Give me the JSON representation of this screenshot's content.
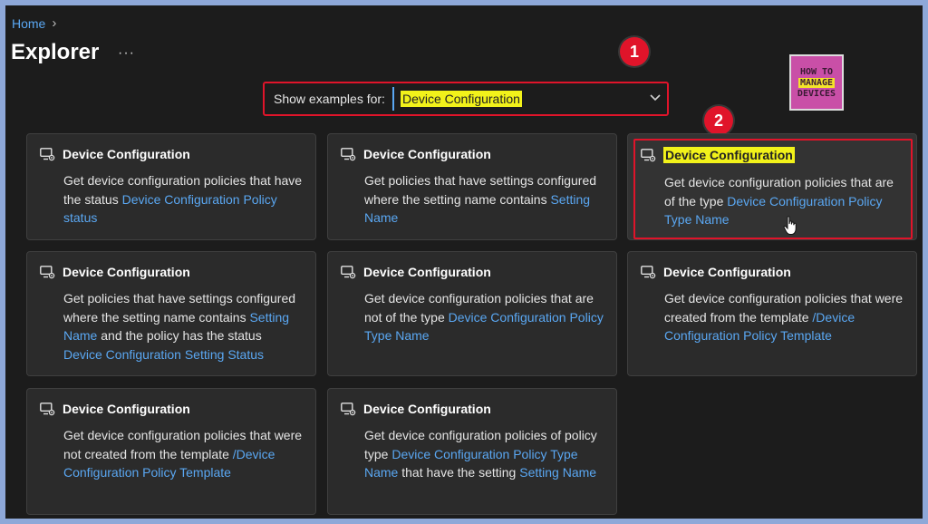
{
  "breadcrumb": {
    "home": "Home"
  },
  "page_title": "Explorer",
  "more_label": "···",
  "filter": {
    "label": "Show examples for:",
    "value": "Device Configuration"
  },
  "markers": [
    "1",
    "2"
  ],
  "logo": {
    "line1": "HOW TO",
    "line2": "MANAGE",
    "line3": "DEVICES"
  },
  "colors": {
    "accent": "#5aa7f2",
    "highlight": "#f2f21a",
    "annotation": "#e0142a",
    "card_bg": "#2b2b2b",
    "page_bg": "#1c1c1c"
  },
  "cards": [
    {
      "title": "Device Configuration",
      "icon": "device-settings-icon",
      "desc": [
        {
          "t": "Get device configuration policies that have the status "
        },
        {
          "t": "Device Configuration Policy status",
          "link": true
        }
      ]
    },
    {
      "title": "Device Configuration",
      "icon": "device-settings-icon",
      "desc": [
        {
          "t": "Get policies that have settings configured where the setting name contains "
        },
        {
          "t": "Setting Name",
          "link": true
        }
      ]
    },
    {
      "title": "Device Configuration",
      "icon": "device-settings-icon",
      "highlighted": true,
      "desc": [
        {
          "t": "Get device configuration policies that are of the type "
        },
        {
          "t": "Device Configuration Policy Type Name",
          "link": true
        }
      ]
    },
    {
      "title": "Device Configuration",
      "icon": "device-settings-icon",
      "desc": [
        {
          "t": "Get policies that have settings configured where the setting name contains "
        },
        {
          "t": "Setting Name",
          "link": true
        },
        {
          "t": " and the policy has the status "
        },
        {
          "t": "Device Configuration Setting Status",
          "link": true
        }
      ]
    },
    {
      "title": "Device Configuration",
      "icon": "device-settings-icon",
      "desc": [
        {
          "t": "Get device configuration policies that are not of the type "
        },
        {
          "t": "Device Configuration Policy Type Name",
          "link": true
        }
      ]
    },
    {
      "title": "Device Configuration",
      "icon": "device-settings-icon",
      "desc": [
        {
          "t": "Get device configuration policies that were created from the template "
        },
        {
          "t": "/Device Configuration Policy Template",
          "link": true
        }
      ]
    },
    {
      "title": "Device Configuration",
      "icon": "device-settings-icon",
      "desc": [
        {
          "t": "Get device configuration policies that were not created from the template "
        },
        {
          "t": "/Device Configuration Policy Template",
          "link": true
        }
      ]
    },
    {
      "title": "Device Configuration",
      "icon": "device-settings-icon",
      "desc": [
        {
          "t": "Get device configuration policies of policy type "
        },
        {
          "t": "Device Configuration Policy Type Name",
          "link": true
        },
        {
          "t": " that have the setting "
        },
        {
          "t": "Setting Name",
          "link": true
        }
      ]
    }
  ]
}
